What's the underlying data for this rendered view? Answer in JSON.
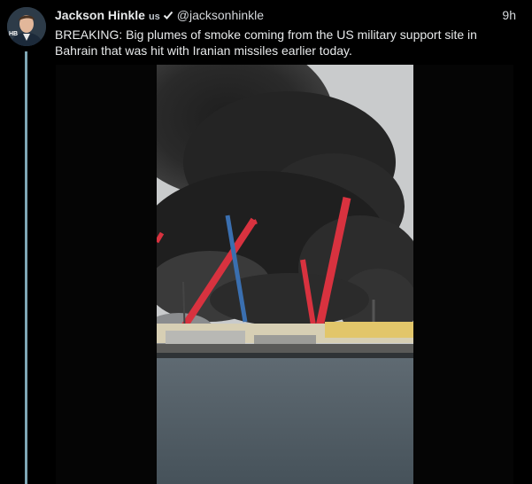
{
  "tweet": {
    "author_name": "Jackson Hinkle",
    "country_flag": "us",
    "verified_icon": "check-icon",
    "handle": "@jacksonhinkle",
    "time": "9h",
    "text": "BREAKING: Big plumes of smoke coming from the US military support site in Bahrain that was hit with Iranian missiles earlier today."
  },
  "avatar": {
    "badge_text": "HB"
  },
  "media": {
    "type": "video-frame",
    "icons": [
      "smoke-plume",
      "crane-icon",
      "ship-icon"
    ]
  },
  "colors": {
    "background": "#000000",
    "text": "#e7e9ea",
    "thread_line": "#7fa7b5",
    "crane_red": "#d8323f",
    "crane_blue": "#3a6fb0"
  }
}
